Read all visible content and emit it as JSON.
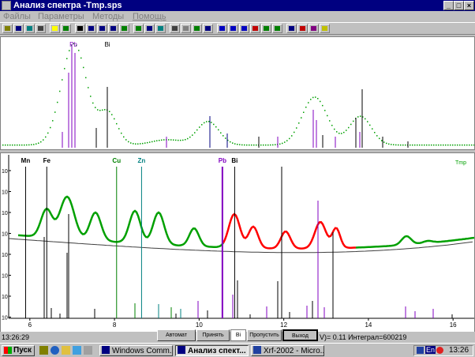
{
  "window": {
    "title": "Анализ спектра -Tmp.sps",
    "controls": {
      "minimize": "_",
      "maximize": "□",
      "close": "×"
    }
  },
  "menu": {
    "items": [
      "Файлы",
      "Параметры",
      "Методы",
      "Помощь"
    ]
  },
  "toolbar": {
    "icons": [
      "open-icon",
      "save-icon",
      "table-icon",
      "print-icon",
      "help-icon",
      "cursor-icon",
      "window-icon",
      "marker-left-icon",
      "marker-right-icon",
      "marker-both-icon",
      "expand-icon",
      "peak-icon",
      "zoom-icon",
      "fit-icon",
      "grid-icon",
      "export-icon",
      "tree-icon",
      "question-icon",
      "calc-icon",
      "calc2-icon",
      "calc3-icon",
      "calc4-icon",
      "compare-icon",
      "fit-line-icon",
      "curve-icon",
      "bar-icon",
      "bar2-icon",
      "color-icon"
    ]
  },
  "colors": {
    "green_points": "#00a000",
    "green_fit": "#00a000",
    "red_fit": "#ff0000",
    "purple_line": "#8000c0",
    "black_line": "#000000",
    "cu_line": "#008000",
    "zn_line": "#008080",
    "title_bar": "#000080"
  },
  "top_chart": {
    "labels": [
      {
        "text": "Pb",
        "x": 6.52
      },
      {
        "text": "Bi",
        "x": 7.41
      }
    ]
  },
  "chart_data": {
    "type": "line",
    "xlim": [
      5.5,
      16.5
    ],
    "xticks": [
      6,
      8,
      10,
      12,
      14,
      16
    ],
    "yticks": [
      "10",
      "10",
      "10",
      "10",
      "10",
      "10",
      "10",
      "10"
    ],
    "element_labels": [
      {
        "text": "Mn",
        "x": 5.9,
        "color": "#000000"
      },
      {
        "text": "Fe",
        "x": 6.4,
        "color": "#000000"
      },
      {
        "text": "Cu",
        "x": 8.05,
        "color": "#008000"
      },
      {
        "text": "Zn",
        "x": 8.64,
        "color": "#008080"
      },
      {
        "text": "Pb",
        "x": 10.55,
        "color": "#8000c0"
      },
      {
        "text": "Bi",
        "x": 10.84,
        "color": "#000000"
      }
    ],
    "legend": "Tmp"
  },
  "status": {
    "time": "13:26:29",
    "text": "V)= 0.11  Интеграл=600219"
  },
  "buttons": [
    {
      "label": "Автомат"
    },
    {
      "label": "Принять"
    },
    {
      "label": "Bi"
    },
    {
      "label": "Пропустить"
    },
    {
      "label": "Выход"
    }
  ],
  "taskbar": {
    "start": "Пуск",
    "tasks": [
      {
        "label": "Windows Comm..."
      },
      {
        "label": "Анализ спект..."
      },
      {
        "label": "Xrf-2002 - Micro..."
      }
    ],
    "lang": "En",
    "clock": "13:26"
  }
}
